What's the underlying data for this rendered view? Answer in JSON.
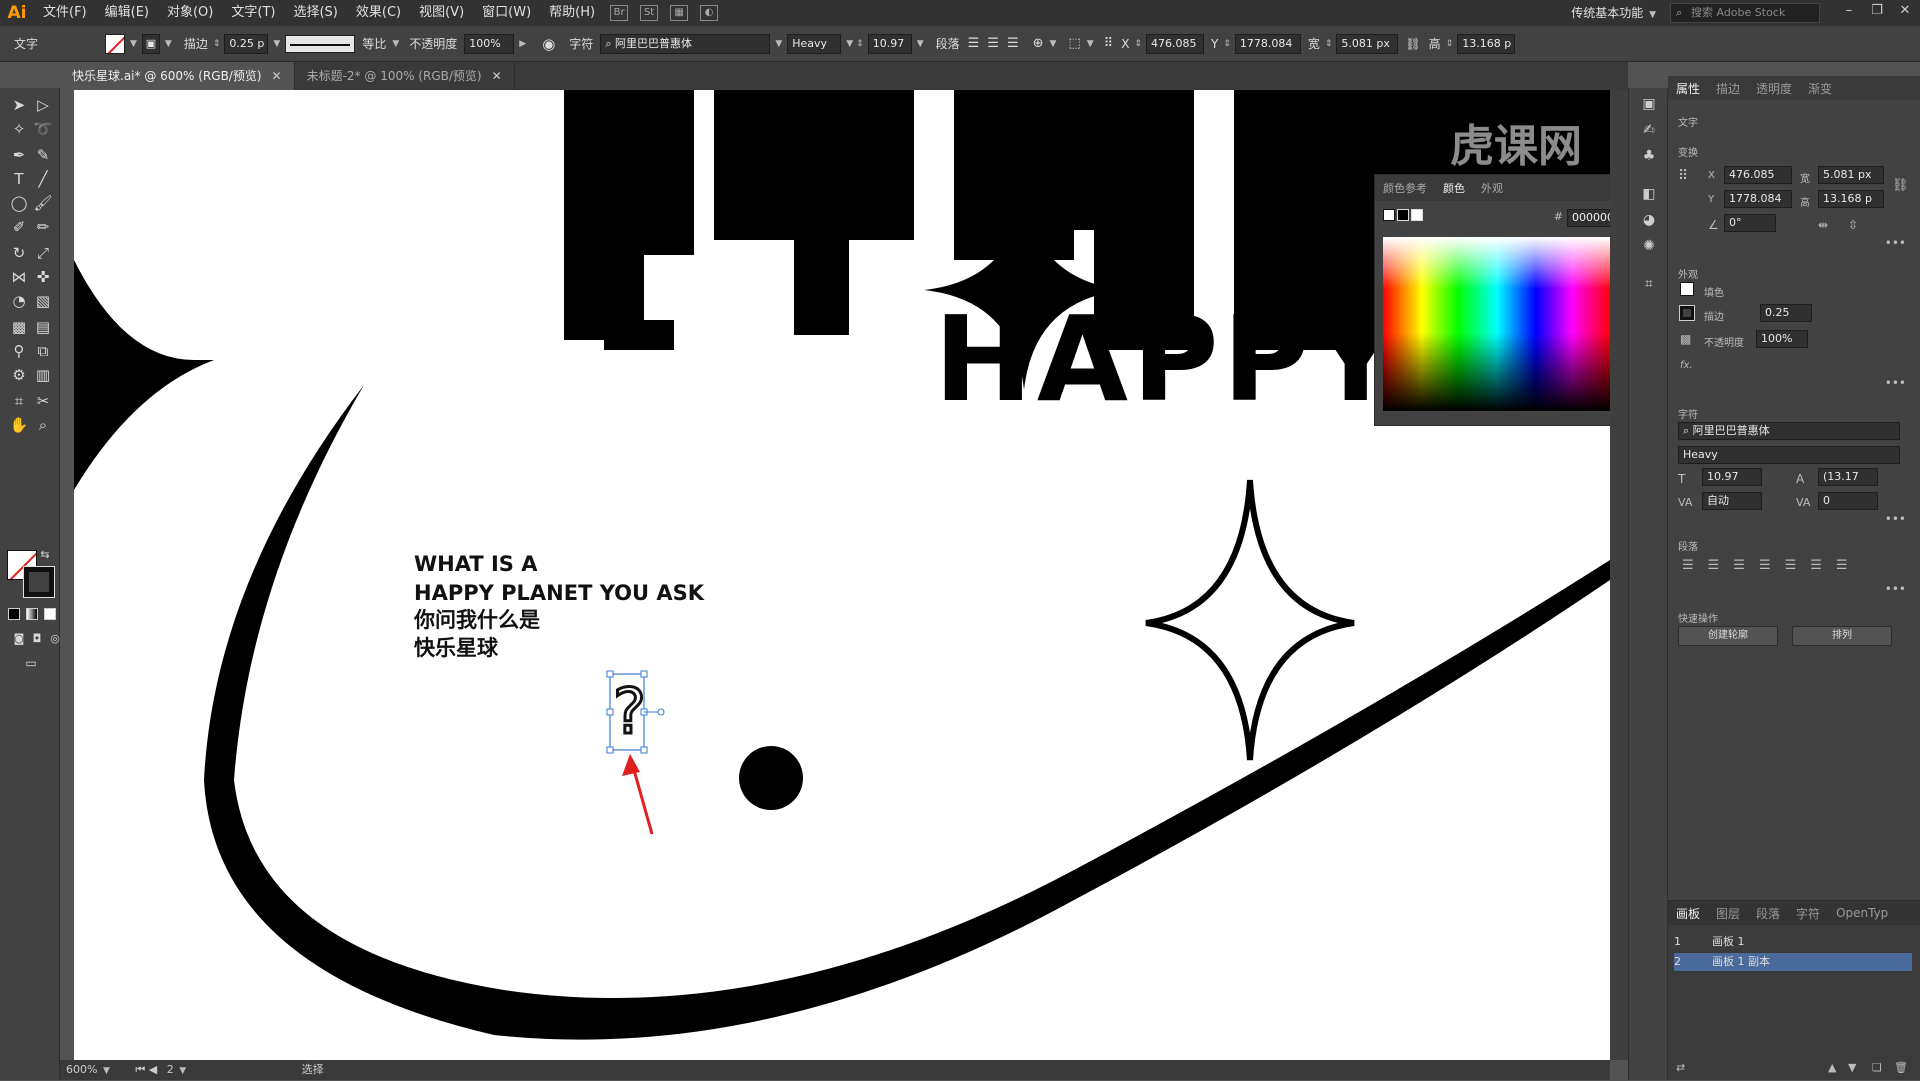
{
  "app": {
    "logo": "Ai"
  },
  "menu": [
    "文件(F)",
    "编辑(E)",
    "对象(O)",
    "文字(T)",
    "选择(S)",
    "效果(C)",
    "视图(V)",
    "窗口(W)",
    "帮助(H)"
  ],
  "workspace": "传统基本功能",
  "stock_search": {
    "placeholder": "搜索 Adobe Stock"
  },
  "watermark": "虎课网",
  "control": {
    "mode_label": "文字",
    "stroke_label": "描边",
    "stroke_value": "0.25 p",
    "stroke_profile": "等比",
    "opacity_label": "不透明度",
    "opacity_value": "100%",
    "char_label": "字符",
    "font_name": "阿里巴巴普惠体",
    "font_style": "Heavy",
    "font_size": "10.97",
    "para_label": "段落",
    "x_label": "X",
    "x_value": "476.085",
    "y_label": "Y",
    "y_value": "1778.084",
    "w_label": "宽",
    "w_value": "5.081 px",
    "h_label": "高",
    "h_value": "13.168 p"
  },
  "tabs": [
    {
      "label": "快乐星球.ai* @ 600% (RGB/预览)",
      "active": true
    },
    {
      "label": "未标题-2* @ 100% (RGB/预览)",
      "active": false
    }
  ],
  "artwork": {
    "line1": "WHAT IS A",
    "line2": "HAPPY PLANET YOU ASK",
    "cn1": "你问我什么是",
    "cn2": "快乐星球",
    "question_glyph": "?",
    "big_happy": "HAPPY P"
  },
  "color_panel": {
    "tabs": [
      "颜色参考",
      "颜色",
      "外观"
    ],
    "hex_prefix": "#",
    "hex": "000000"
  },
  "props": {
    "tabs": [
      "属性",
      "描边",
      "透明度",
      "渐变"
    ],
    "section_text": "文字",
    "section_transform": "变换",
    "x": "476.085",
    "y": "1778.084",
    "w": "5.081 px",
    "h": "13.168 p",
    "angle": "0°",
    "section_appearance": "外观",
    "fill_label": "填色",
    "stroke_label": "描边",
    "stroke_value": "0.25",
    "opacity_label": "不透明度",
    "opacity_value": "100%",
    "fx_label": "fx.",
    "section_char": "字符",
    "font_name": "阿里巴巴普惠体",
    "font_style": "Heavy",
    "font_size": "10.97",
    "leading": "(13.17",
    "tracking_mode": "自动",
    "tracking": "0",
    "section_para": "段落",
    "section_quick": "快速操作",
    "btn_outline": "创建轮廓",
    "btn_arrange": "排列"
  },
  "artboards_panel": {
    "tabs": [
      "画板",
      "图层",
      "段落",
      "字符",
      "OpenTyp"
    ],
    "rows": [
      {
        "num": "1",
        "name": "画板 1",
        "selected": false
      },
      {
        "num": "2",
        "name": "画板 1 副本",
        "selected": true
      }
    ]
  },
  "status": {
    "zoom": "600%",
    "page": "2",
    "mode": "选择"
  },
  "colors": {
    "accent": "#ff9a00",
    "selection": "#4a6a9c",
    "arrow": "#e0201e"
  }
}
